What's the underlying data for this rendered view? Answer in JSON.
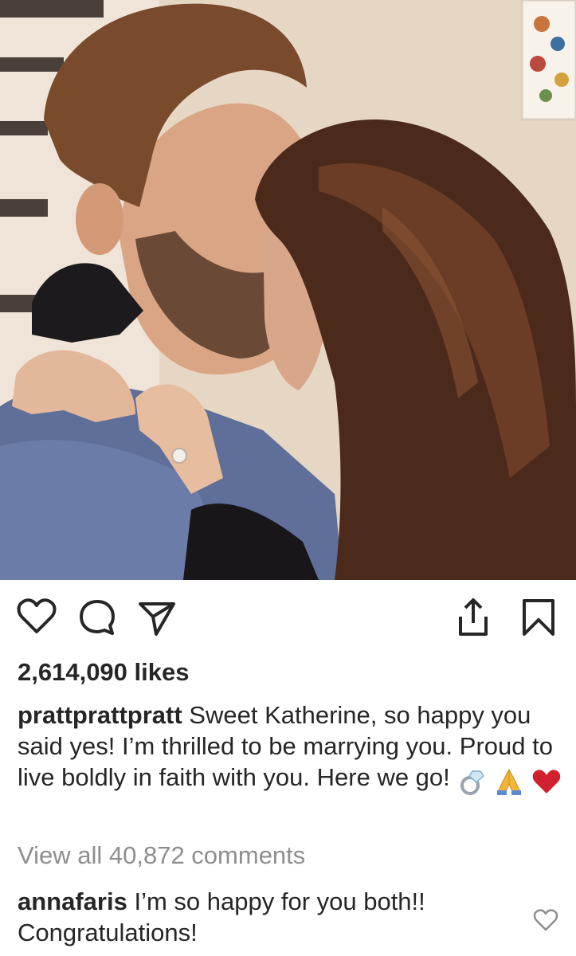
{
  "post": {
    "photo_alt": "",
    "likes_label": "2,614,090 likes",
    "caption": {
      "username": "prattprattpratt",
      "text": "Sweet Katherine, so happy you said yes! I’m thrilled to be marrying you. Proud to live boldly in faith with you. Here we go!"
    },
    "view_comments_label": "View all 40,872 comments",
    "top_comment": {
      "username": "annafaris",
      "text": "I’m so happy for you both!! Congratulations!"
    }
  },
  "icons": {
    "like": "heart-outline-icon",
    "comment": "speech-bubble-icon",
    "share": "paper-plane-icon",
    "upload": "share-upload-icon",
    "save": "bookmark-icon",
    "comment_like": "small-heart-icon",
    "emojis": [
      "ring-emoji",
      "praying-hands-emoji",
      "red-heart-emoji"
    ]
  },
  "colors": {
    "text": "#262626",
    "muted": "#8e8e8e",
    "heart_red": "#d1202e"
  }
}
